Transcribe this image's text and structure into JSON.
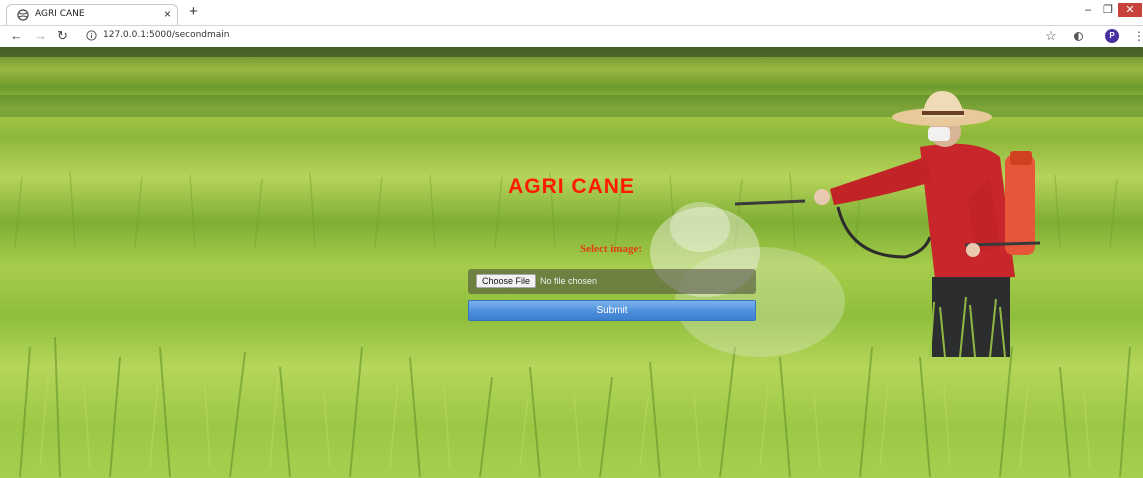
{
  "browser": {
    "tab_title": "AGRI CANE",
    "tab_close": "×",
    "new_tab": "+",
    "url": "127.0.0.1:5000/secondmain",
    "profile_initial": "P",
    "window_controls": {
      "minimize": "–",
      "maximize": "❐",
      "close": "✕"
    },
    "nav": {
      "back": "←",
      "forward": "→",
      "reload": "↻",
      "bookmark": "☆",
      "menu": "⋮"
    }
  },
  "page": {
    "title": "AGRI CANE",
    "select_label": "Select image:",
    "file_button": "Choose File",
    "file_status": "No file chosen",
    "submit_label": "Submit"
  },
  "colors": {
    "title": "#ff1a00",
    "label": "#e23c12",
    "submit": "#4d8fdc",
    "close_button": "#c7423a"
  }
}
